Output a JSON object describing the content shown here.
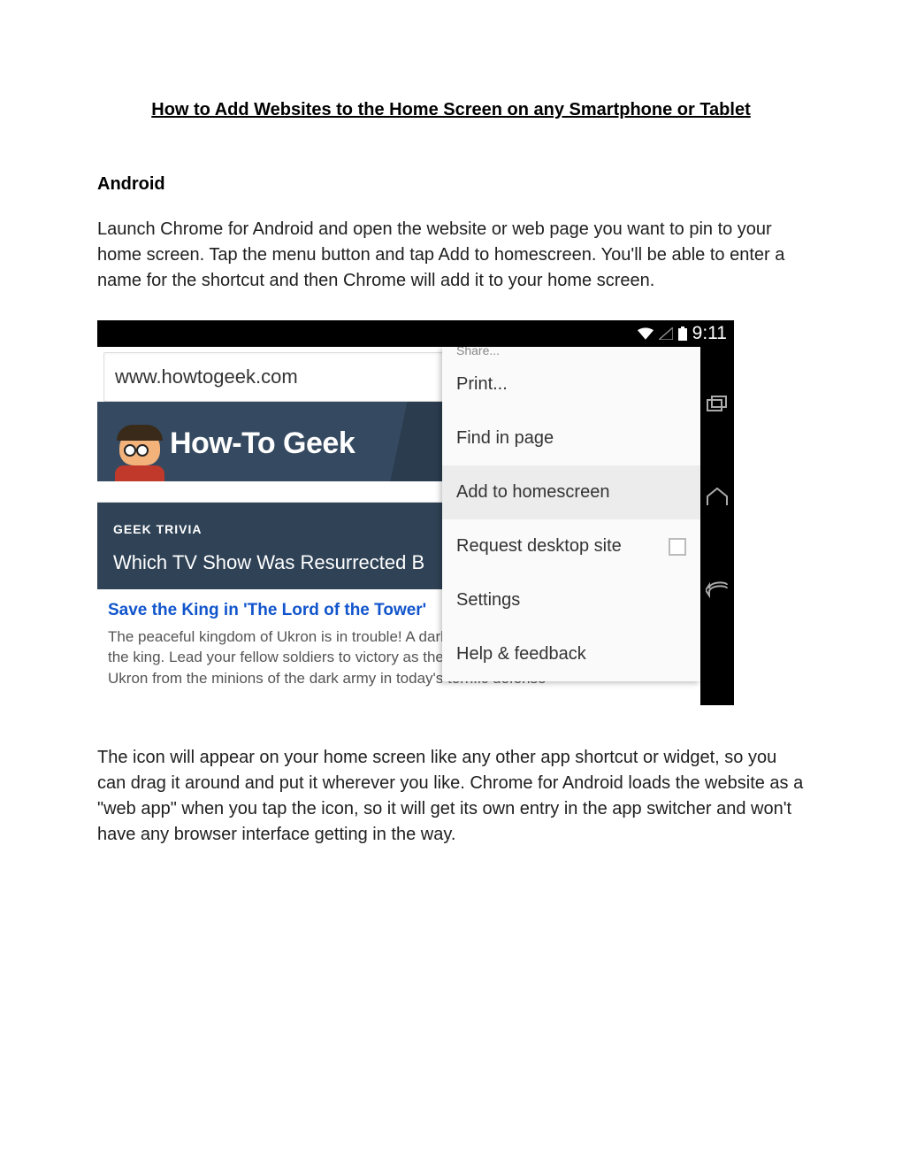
{
  "doc": {
    "title": "How to Add Websites to the Home Screen on any Smartphone or Tablet",
    "section_heading": "Android",
    "para1": "Launch Chrome for Android and open the website or web page you want to pin to your home screen. Tap the menu button and tap Add to homescreen. You'll be able to enter a name for the shortcut and then Chrome will add it to your home screen.",
    "para2": "The icon will appear on your home screen like any other app shortcut or widget, so you can drag it around and put it wherever you like. Chrome for Android loads the website as a \"web app\" when you tap the icon, so it will get its own entry in the app switcher and won't have any browser interface getting in the way."
  },
  "screenshot": {
    "status_time": "9:11",
    "url": "www.howtogeek.com",
    "site_name": "How-To Geek",
    "trivia_label": "GEEK TRIVIA",
    "trivia_question": "Which TV Show Was Resurrected B",
    "article_title": "Save the King in 'The Lord of the Tower'",
    "article_body": "The peaceful kingdom of Ukron is in trouble! A dark a    kingdom and seeks to dethrone the king. Lead your fellow soldiers to victory as they work to defend the king and save Ukron from the minions of the dark army in today's terrific defense",
    "menu": {
      "share_cut": "Share...",
      "print": "Print...",
      "find": "Find in page",
      "add": "Add to homescreen",
      "desktop": "Request desktop site",
      "settings": "Settings",
      "help": "Help & feedback"
    }
  }
}
